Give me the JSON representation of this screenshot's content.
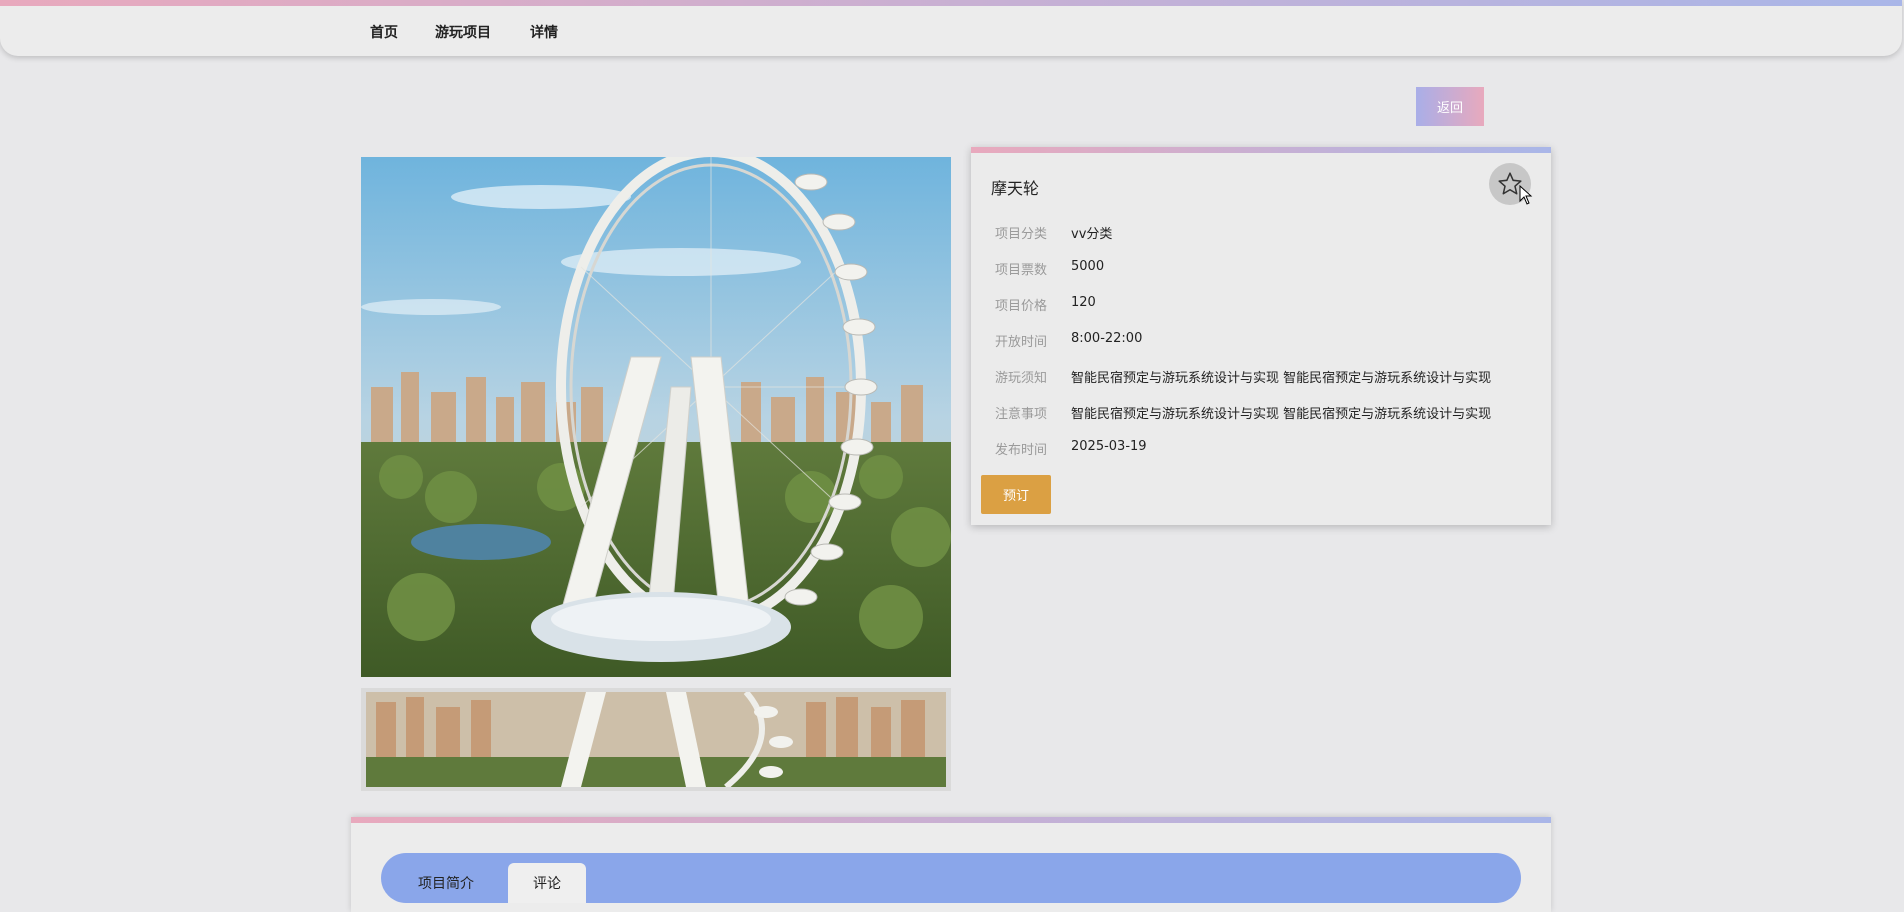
{
  "nav": {
    "items": [
      {
        "label": "首页"
      },
      {
        "label": "游玩项目"
      },
      {
        "label": "详情"
      }
    ]
  },
  "back_button": {
    "label": "返回"
  },
  "detail": {
    "title": "摩天轮",
    "star_icon": "star-icon",
    "fields": [
      {
        "label": "项目分类",
        "value": "vv分类"
      },
      {
        "label": "项目票数",
        "value": "5000"
      },
      {
        "label": "项目价格",
        "value": "120"
      },
      {
        "label": "开放时间",
        "value": "8:00-22:00"
      },
      {
        "label": "游玩须知",
        "value": "智能民宿预定与游玩系统设计与实现 智能民宿预定与游玩系统设计与实现"
      },
      {
        "label": "注意事项",
        "value": "智能民宿预定与游玩系统设计与实现 智能民宿预定与游玩系统设计与实现"
      },
      {
        "label": "发布时间",
        "value": "2025-03-19"
      }
    ],
    "book_label": "预订"
  },
  "tabs": [
    {
      "label": "项目简介"
    },
    {
      "label": "评论",
      "active": true
    }
  ],
  "colors": {
    "accent_pink": "#e8a9bd",
    "accent_blue": "#a9b6e8",
    "tab_bar": "#8aa6ea",
    "book_button": "#dba043"
  }
}
